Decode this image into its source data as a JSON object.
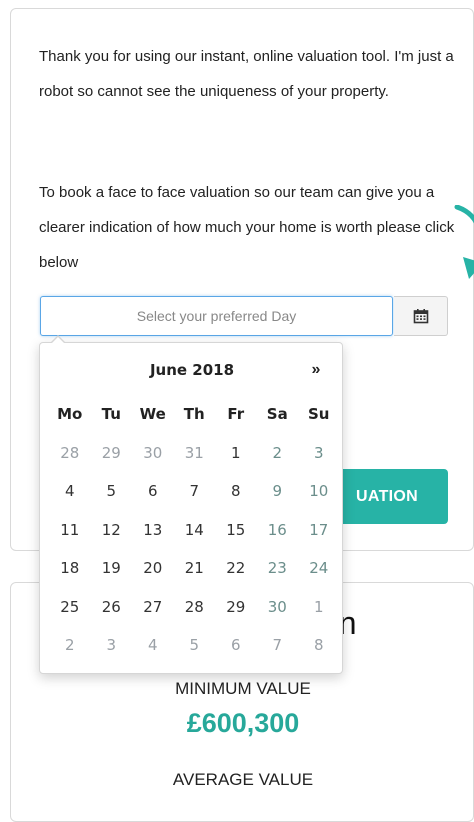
{
  "intro": {
    "paragraph1": "Thank you for using our instant, online valuation tool. I'm just a robot so cannot see the uniqueness of your property.",
    "paragraph2": "To book a face to face valuation so our team can give you a clearer indication of how much your home is worth please click below"
  },
  "day_picker": {
    "placeholder": "Select your preferred Day",
    "calendar_icon": "calendar-icon"
  },
  "book_button": {
    "label": "UATION"
  },
  "datepicker": {
    "month_title": "June 2018",
    "next_symbol": "»",
    "weekdays": [
      "Mo",
      "Tu",
      "We",
      "Th",
      "Fr",
      "Sa",
      "Su"
    ],
    "weeks": [
      [
        "28",
        "29",
        "30",
        "31",
        "1",
        "2",
        "3"
      ],
      [
        "4",
        "5",
        "6",
        "7",
        "8",
        "9",
        "10"
      ],
      [
        "11",
        "12",
        "13",
        "14",
        "15",
        "16",
        "17"
      ],
      [
        "18",
        "19",
        "20",
        "21",
        "22",
        "23",
        "24"
      ],
      [
        "25",
        "26",
        "27",
        "28",
        "29",
        "30",
        "1"
      ],
      [
        "2",
        "3",
        "4",
        "5",
        "6",
        "7",
        "8"
      ]
    ]
  },
  "valuation": {
    "heading_fragment": "on",
    "minimum_label": "MINIMUM VALUE",
    "minimum_value": "£600,300",
    "average_label": "AVERAGE VALUE"
  },
  "colors": {
    "accent": "#27b3a6",
    "value_text": "#27a89a",
    "input_focus": "#5aa6e6"
  }
}
